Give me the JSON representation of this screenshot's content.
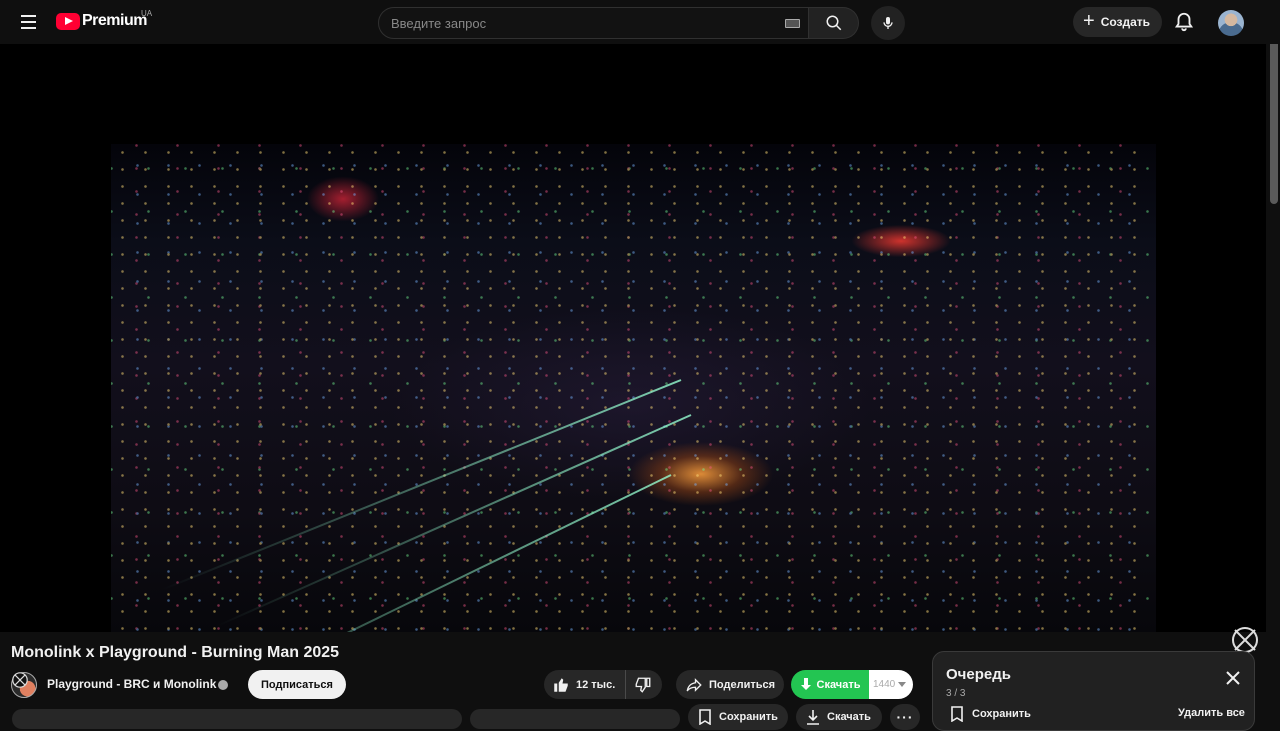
{
  "masthead": {
    "logo_text": "Premium",
    "logo_country": "UA",
    "search_placeholder": "Введите запрос",
    "create_label": "Создать"
  },
  "video": {
    "title": "Monolink x Playground - Burning Man 2025"
  },
  "channel": {
    "name": "Playground - BRC и Monolink",
    "subscribe_label": "Подписаться"
  },
  "actions": {
    "like_count": "12 тыс.",
    "share_label": "Поделиться",
    "download_label": "Скачать",
    "quality_value": "1440",
    "save_label": "Сохранить",
    "download_label_2": "Скачать"
  },
  "queue": {
    "title": "Очередь",
    "position": "3 / 3",
    "save_label": "Сохранить",
    "remove_all_label": "Удалить все"
  },
  "colors": {
    "brand_red": "#ff0033",
    "download_green": "#23c552",
    "background": "#0f0f0f"
  }
}
